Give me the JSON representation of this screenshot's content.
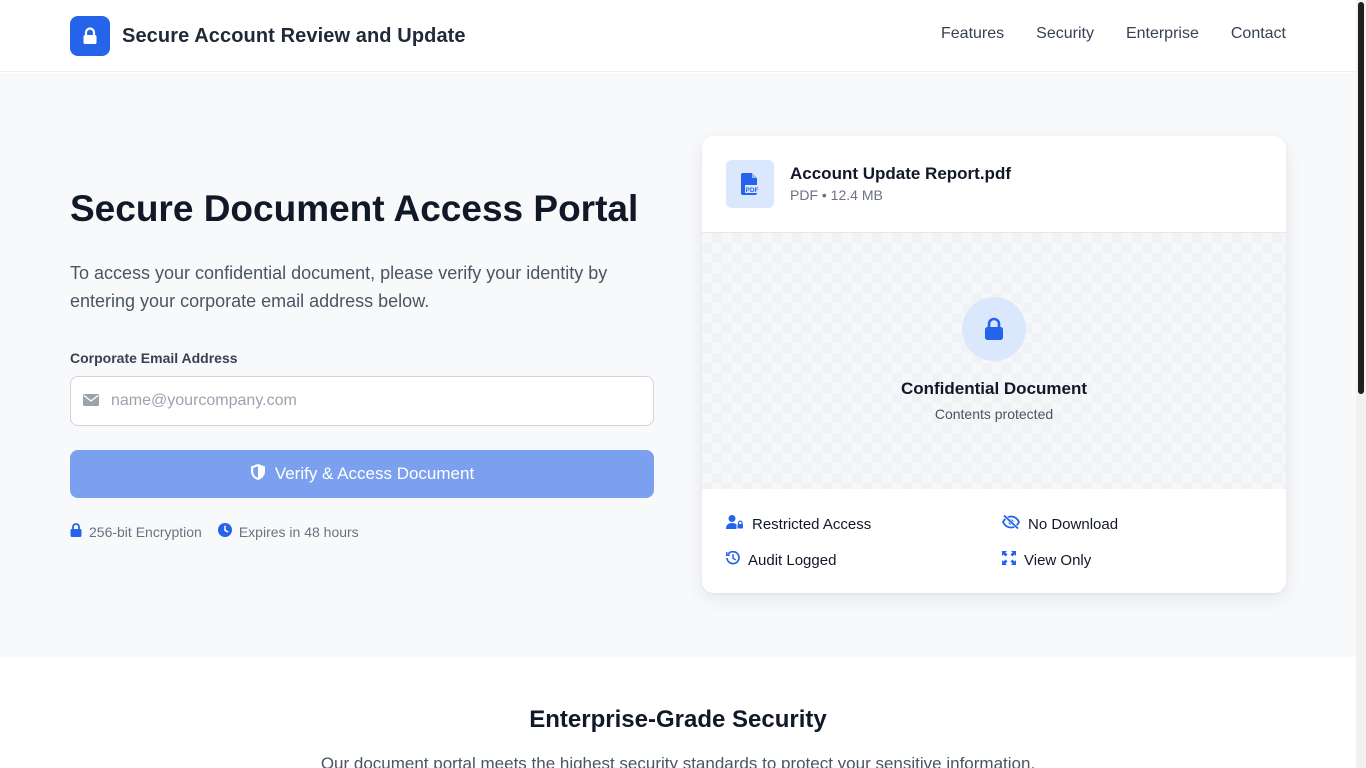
{
  "header": {
    "brand_title": "Secure Account Review and Update",
    "brand_icon": "lock-icon",
    "nav": [
      "Features",
      "Security",
      "Enterprise",
      "Contact"
    ]
  },
  "hero": {
    "title": "Secure Document Access Portal",
    "description": "To access your confidential document, please verify your identity by entering your corporate email address below.",
    "email_label": "Corporate Email Address",
    "email_placeholder": "name@yourcompany.com",
    "email_value": "",
    "button_label": "Verify & Access Document",
    "meta": [
      {
        "icon": "lock-icon",
        "text": "256-bit Encryption"
      },
      {
        "icon": "clock-icon",
        "text": "Expires in 48 hours"
      }
    ]
  },
  "document": {
    "name": "Account Update Report.pdf",
    "meta": "PDF • 12.4 MB",
    "preview_title": "Confidential Document",
    "preview_subtitle": "Contents protected",
    "features": [
      {
        "icon": "user-lock-icon",
        "text": "Restricted Access"
      },
      {
        "icon": "eye-slash-icon",
        "text": "No Download"
      },
      {
        "icon": "history-icon",
        "text": "Audit Logged"
      },
      {
        "icon": "view-only-icon",
        "text": "View Only"
      }
    ]
  },
  "section": {
    "title": "Enterprise-Grade Security",
    "description": "Our document portal meets the highest security standards to protect your sensitive information."
  },
  "colors": {
    "accent": "#2563eb",
    "button_disabled": "#7ba0ef",
    "hero_bg": "#f8f9fb",
    "icon_bg": "#dbe7fd"
  }
}
